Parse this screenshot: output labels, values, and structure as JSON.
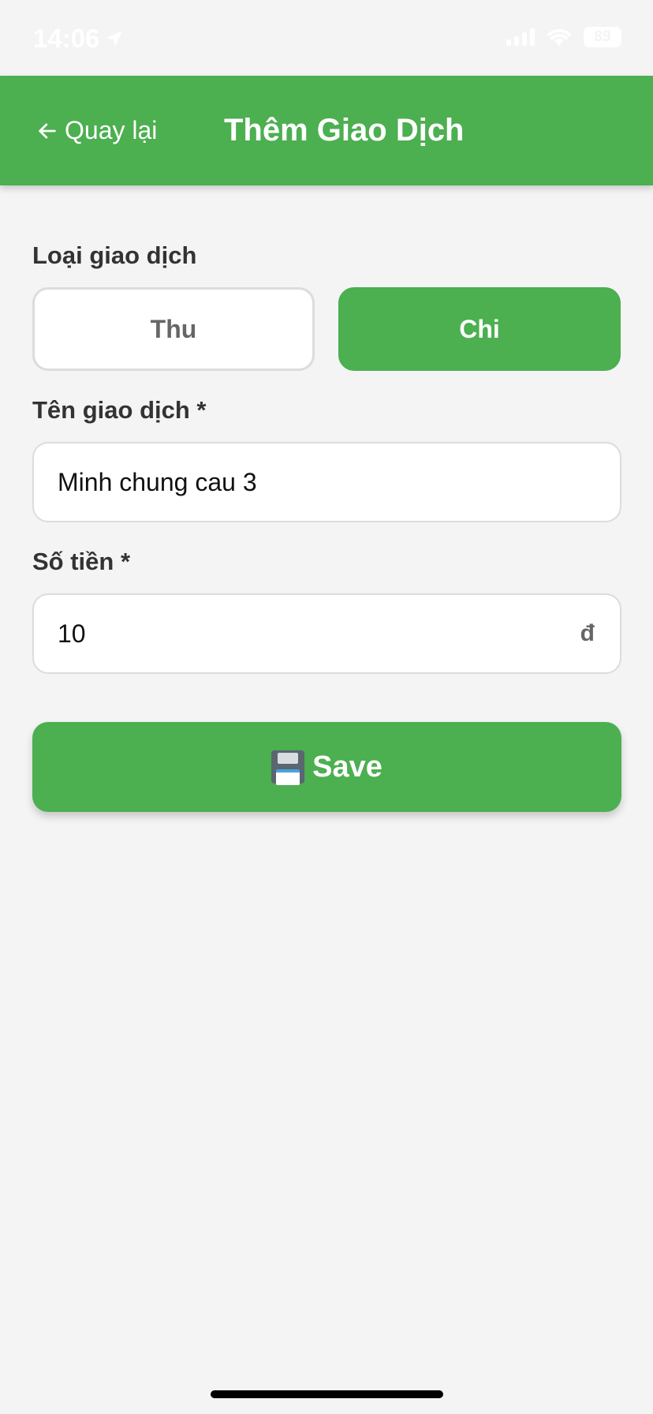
{
  "status_bar": {
    "time": "14:06",
    "battery": "89"
  },
  "header": {
    "back_label": "Quay lại",
    "title": "Thêm Giao Dịch"
  },
  "form": {
    "type_label": "Loại giao dịch",
    "type_options": [
      "Thu",
      "Chi"
    ],
    "selected_type": "Chi",
    "name_label": "Tên giao dịch *",
    "name_value": "Minh chung cau 3",
    "amount_label": "Số tiền *",
    "amount_value": "10",
    "currency_symbol": "đ"
  },
  "save_button": {
    "label": "Save",
    "icon": "floppy-disk-icon"
  },
  "colors": {
    "accent": "#4caf50",
    "background": "#f4f4f4"
  }
}
